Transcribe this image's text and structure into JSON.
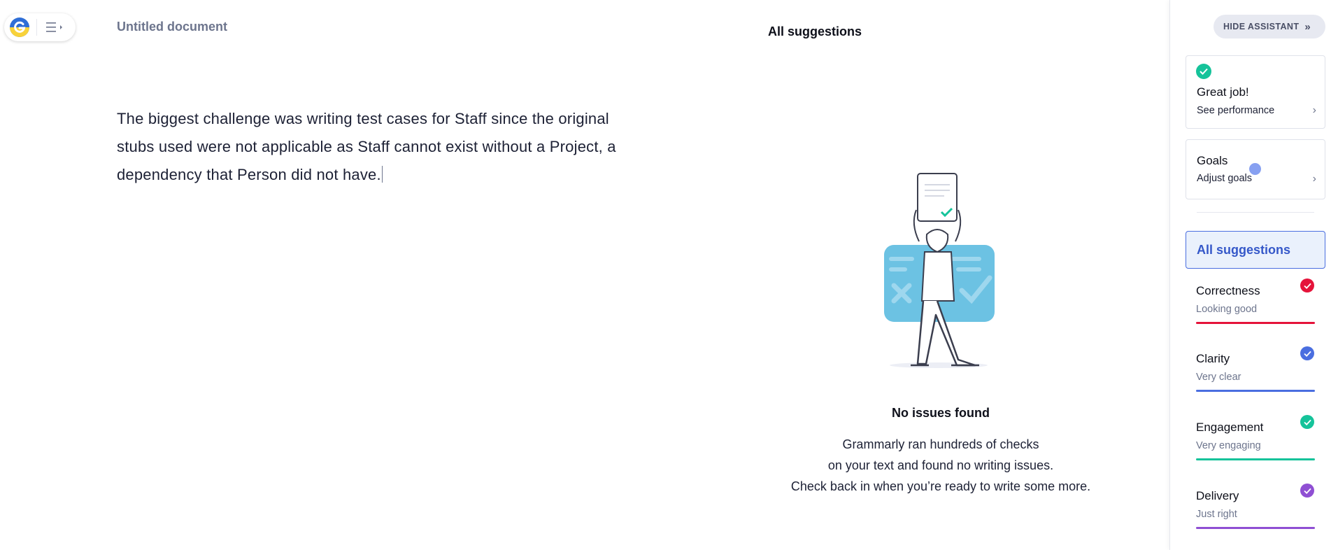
{
  "document": {
    "title": "Untitled document",
    "body": "The biggest challenge was writing test cases for Staff since the original stubs used were not applicable as Staff cannot exist without a Project, a dependency that Person did not have."
  },
  "suggestions_panel": {
    "heading": "All suggestions",
    "empty_title": "No issues found",
    "empty_lines": [
      "Grammarly ran hundreds of checks",
      "on your text and found no writing issues.",
      "Check back in when you’re ready to write some more."
    ]
  },
  "sidebar": {
    "hide_button": "HIDE ASSISTANT",
    "performance": {
      "title": "Great job!",
      "subtitle": "See performance"
    },
    "goals": {
      "title": "Goals",
      "subtitle": "Adjust goals"
    },
    "all_suggestions": "All suggestions",
    "metrics": [
      {
        "title": "Correctness",
        "status": "Looking good",
        "color": "#e5133a"
      },
      {
        "title": "Clarity",
        "status": "Very clear",
        "color": "#4a6ee0"
      },
      {
        "title": "Engagement",
        "status": "Very engaging",
        "color": "#15c39a"
      },
      {
        "title": "Delivery",
        "status": "Just right",
        "color": "#8f4fd3"
      }
    ]
  },
  "icons": {
    "logo": "grammarly-logo-icon",
    "menu": "menu-icon",
    "chevron": "chevron-right-icon",
    "check": "check-circle-icon"
  },
  "colors": {
    "accent_blue": "#4a6ee0",
    "green": "#15c39a",
    "red": "#e5133a",
    "purple": "#8f4fd3"
  }
}
